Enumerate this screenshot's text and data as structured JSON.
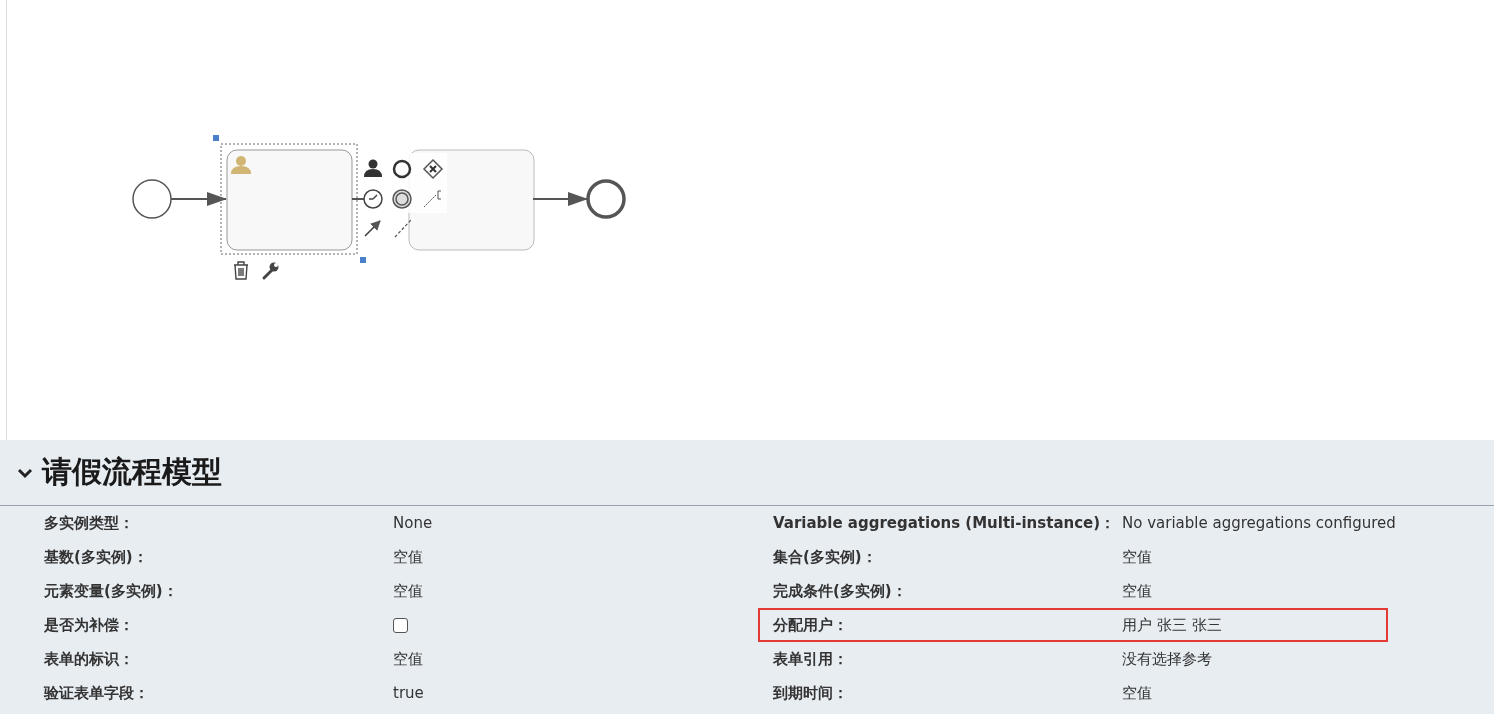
{
  "diagram": {
    "tasks": [
      {
        "selected": true
      },
      {
        "selected": false
      }
    ]
  },
  "panel": {
    "title": "请假流程模型",
    "expanded": true,
    "rows": [
      {
        "left": {
          "label": "多实例类型：",
          "kind": "text",
          "value": "None"
        },
        "right": {
          "label": "Variable aggregations (Multi-instance)：",
          "kind": "text",
          "value": "No variable aggregations configured",
          "highlighted": false
        }
      },
      {
        "left": {
          "label": "基数(多实例)：",
          "kind": "text",
          "value": "空值"
        },
        "right": {
          "label": "集合(多实例)：",
          "kind": "text",
          "value": "空值",
          "highlighted": false
        }
      },
      {
        "left": {
          "label": "元素变量(多实例)：",
          "kind": "text",
          "value": "空值"
        },
        "right": {
          "label": "完成条件(多实例)：",
          "kind": "text",
          "value": "空值",
          "highlighted": false
        }
      },
      {
        "left": {
          "label": "是否为补偿：",
          "kind": "checkbox",
          "checked": false
        },
        "right": {
          "label": "分配用户：",
          "kind": "text",
          "value": "用户 张三 张三",
          "highlighted": true
        }
      },
      {
        "left": {
          "label": "表单的标识：",
          "kind": "text",
          "value": "空值"
        },
        "right": {
          "label": "表单引用：",
          "kind": "text",
          "value": "没有选择参考",
          "highlighted": false
        }
      },
      {
        "left": {
          "label": "验证表单字段：",
          "kind": "text",
          "value": "true"
        },
        "right": {
          "label": "到期时间：",
          "kind": "text",
          "value": "空值",
          "highlighted": false
        }
      }
    ]
  }
}
